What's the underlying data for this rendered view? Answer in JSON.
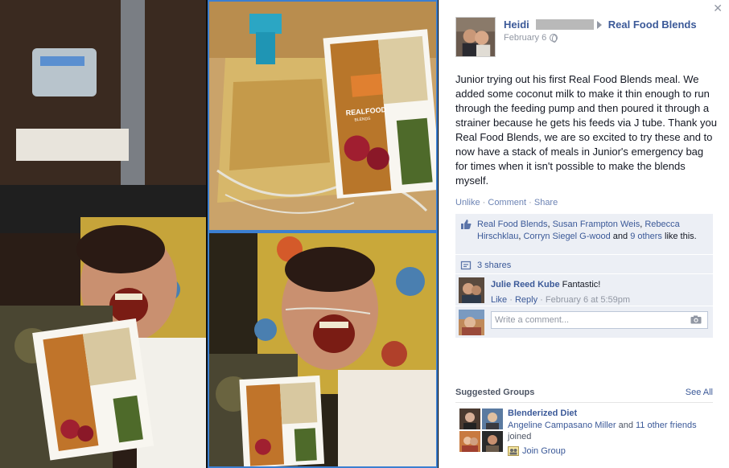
{
  "photos": {
    "book_title": "REALFOOD",
    "book_subtitle": "BLENDS",
    "book_flavor": "Quinoa Kale & Hemp"
  },
  "post": {
    "author_name": "Heidi",
    "page_name": "Real Food Blends",
    "date": "February 6",
    "text": "Junior trying out his first Real Food Blends meal. We added some coconut milk to make it thin enough to run through the feeding pump and then poured it through a strainer because he gets his feeds via J tube. Thank you Real Food Blends, we are so excited to try these and to now have a stack of meals in Junior's emergency bag for times when it isn't possible to make the blends myself."
  },
  "actions": {
    "unlike": "Unlike",
    "comment": "Comment",
    "share": "Share",
    "separator": "·"
  },
  "likes": {
    "names": [
      "Real Food Blends",
      "Susan Frampton Weis",
      "Rebecca Hirschklau",
      "Corryn Siegel G-wood"
    ],
    "and_text": "and",
    "others": "9 others",
    "suffix": "like this."
  },
  "shares": {
    "label": "3 shares"
  },
  "comment": {
    "author": "Julie Reed Kube",
    "text": "Fantastic!",
    "like": "Like",
    "reply": "Reply",
    "timestamp": "February 6 at 5:59pm"
  },
  "write_comment": {
    "placeholder": "Write a comment..."
  },
  "suggested_groups": {
    "heading": "Suggested Groups",
    "see_all": "See All",
    "group_name": "Blenderized Diet",
    "friend_name": "Angeline Campasano Miller",
    "and_text": "and",
    "others": "11 other friends",
    "joined": "joined",
    "join_label": "Join Group"
  },
  "icons": {
    "close": "close-icon",
    "privacy": "globe-icon",
    "like": "thumbs-up-icon",
    "share": "share-icon",
    "camera": "camera-icon",
    "join": "join-group-icon"
  },
  "colors": {
    "link": "#3b5998",
    "ufi_bg": "#eceff5",
    "selection_border": "#3b7fd1",
    "photo_bg": "#0e0e0e"
  }
}
